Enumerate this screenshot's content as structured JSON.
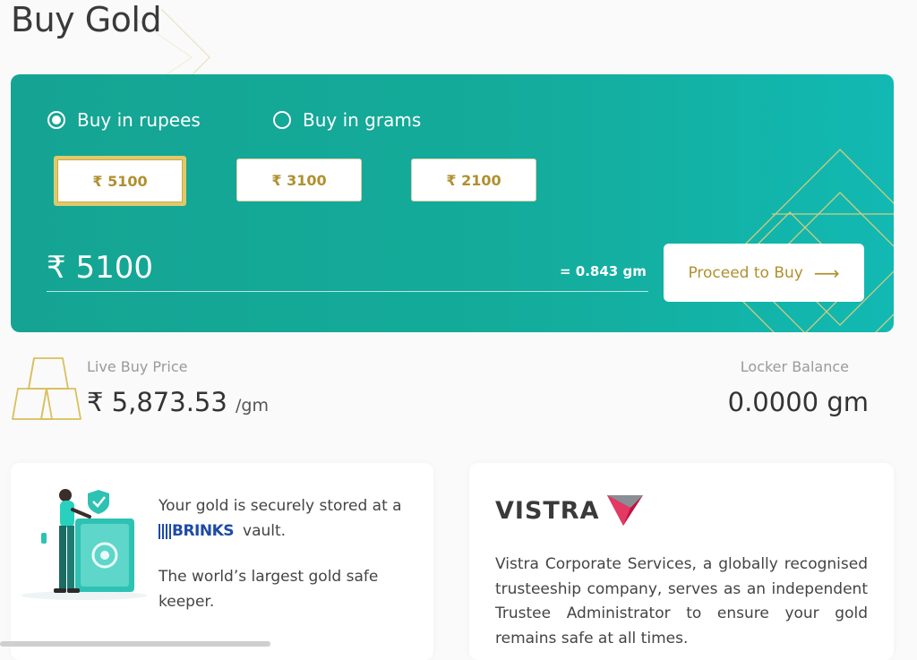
{
  "page": {
    "title": "Buy Gold"
  },
  "buy_card": {
    "options": [
      {
        "label": "Buy in rupees",
        "selected": true
      },
      {
        "label": "Buy in grams",
        "selected": false
      }
    ],
    "amounts": [
      "₹ 5100",
      "₹ 3100",
      "₹ 2100"
    ],
    "amount_value": "₹ 5100",
    "gram_equivalent": "= 0.843 gm",
    "proceed_label": "Proceed to Buy",
    "proceed_arrow": "⟶"
  },
  "price": {
    "label": "Live Buy Price",
    "value": "₹ 5,873.53",
    "unit": "/gm"
  },
  "locker": {
    "label": "Locker Balance",
    "value": "0.0000 gm"
  },
  "vault_card": {
    "line1": "Your gold is securely stored at a",
    "brinks_logo": "BRINKS",
    "line2_suffix": "vault.",
    "description": "The world’s largest gold safe keeper."
  },
  "trustee_card": {
    "logo_text": "VISTRA",
    "description": "Vistra Corporate Services, a globally recognised trusteeship company, serves as an independent Trustee Administrator to ensure your gold remains safe at all times."
  },
  "colors": {
    "teal_start": "#15a493",
    "teal_end": "#12b9b2",
    "gold_text": "#b0902f",
    "brinks_blue": "#1e4aa8",
    "vistra_red": "#c2123f"
  }
}
